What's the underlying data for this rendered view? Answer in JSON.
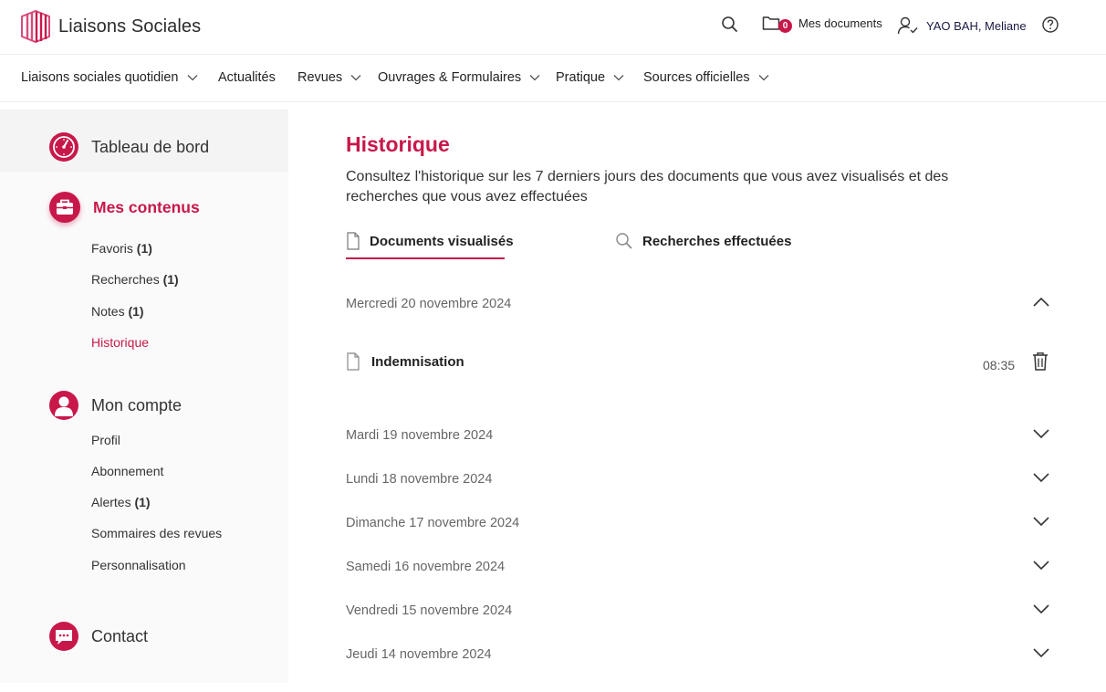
{
  "header": {
    "brand": "Liaisons Sociales",
    "docs_count": "0",
    "docs_label": "Mes documents",
    "user_name": "YAO BAH, Meliane"
  },
  "nav": {
    "items": [
      {
        "label": "Liaisons sociales quotidien",
        "has_menu": true
      },
      {
        "label": "Actualités",
        "has_menu": false
      },
      {
        "label": "Revues",
        "has_menu": true
      },
      {
        "label": "Ouvrages & Formulaires",
        "has_menu": true
      },
      {
        "label": "Pratique",
        "has_menu": true
      },
      {
        "label": "Sources officielles",
        "has_menu": true
      }
    ]
  },
  "sidebar": {
    "dashboard": "Tableau de bord",
    "my_content": {
      "title": "Mes contenus",
      "items": [
        {
          "label": "Favoris",
          "count": "(1)"
        },
        {
          "label": "Recherches",
          "count": "(1)"
        },
        {
          "label": "Notes",
          "count": "(1)"
        },
        {
          "label": "Historique",
          "count": ""
        }
      ]
    },
    "account": {
      "title": "Mon compte",
      "items": [
        {
          "label": "Profil",
          "count": ""
        },
        {
          "label": "Abonnement",
          "count": ""
        },
        {
          "label": "Alertes",
          "count": "(1)"
        },
        {
          "label": "Sommaires des revues",
          "count": ""
        },
        {
          "label": "Personnalisation",
          "count": ""
        }
      ]
    },
    "contact": "Contact"
  },
  "main": {
    "title": "Historique",
    "description": "Consultez l'historique sur les 7 derniers jours des documents que vous avez visualisés et des recherches que vous avez effectuées",
    "tabs": [
      {
        "label": "Documents visualisés",
        "active": true
      },
      {
        "label": "Recherches effectuées",
        "active": false
      }
    ],
    "days": [
      {
        "label": "Mercredi 20 novembre 2024",
        "expanded": true
      },
      {
        "label": "Mardi 19 novembre 2024",
        "expanded": false
      },
      {
        "label": "Lundi 18 novembre 2024",
        "expanded": false
      },
      {
        "label": "Dimanche 17 novembre 2024",
        "expanded": false
      },
      {
        "label": "Samedi 16 novembre 2024",
        "expanded": false
      },
      {
        "label": "Vendredi 15 novembre 2024",
        "expanded": false
      },
      {
        "label": "Jeudi 14 novembre 2024",
        "expanded": false
      }
    ],
    "documents": [
      {
        "title": "Indemnisation",
        "time": "08:35"
      }
    ]
  },
  "colors": {
    "accent": "#c8184a"
  }
}
